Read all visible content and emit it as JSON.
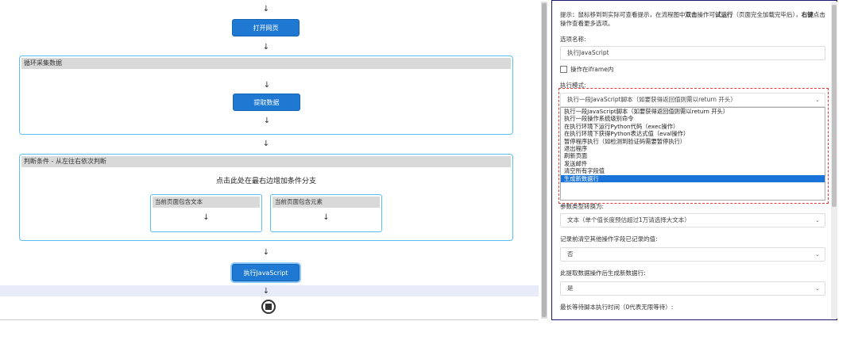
{
  "flow": {
    "open_page": "打开网页",
    "loop_block_title": "循环采集数据",
    "extract_data": "提取数据",
    "condition_block_title": "判断条件 - 从左往右依次判断",
    "branch_hint": "点击此处在最右边增加条件分支",
    "branch_1_title": "当前页面包含文本",
    "branch_2_title": "当前页面包含元素",
    "exec_js": "执行JavaScript",
    "arrow": "↓"
  },
  "panel": {
    "tip_prefix": "提示：鼠标移到到实际可查看提示，在流程图中",
    "tip_double_click": "双击",
    "tip_middle": "操作可",
    "tip_trial": "试运行",
    "tip_after": "（页面完全加载完毕后），",
    "tip_right": "右键",
    "tip_end": "点击操作查看更多选项。",
    "option_name_label": "选项名称:",
    "option_name_value": "执行JavaScript",
    "iframe_label": "操作在iframe内",
    "exec_mode_label": "执行模式:",
    "exec_mode_selected": "执行一段JavaScript脚本（如要获得返回值则需以return 开头）",
    "exec_mode_options": [
      "执行一段JavaScript脚本（如要获得返回值则需以return 开头）",
      "执行一段操作系统级别命令",
      "在执行环境下运行Python代码（exec操作）",
      "在执行环境下获得Python表达式值（eval操作）",
      "暂停程序执行（如检测到验证码需要暂停执行）",
      "退出程序",
      "刷新页面",
      "发送邮件",
      "清空所有字段值",
      "生成新数据行"
    ],
    "param_type_label": "参数类型转换为:",
    "param_type_value": "文本（单个值长度预估超过1万请选择大文本）",
    "clear_fields_label": "记录前清空其他操作字段已记录的值:",
    "clear_fields_value": "否",
    "new_row_label": "此提取数据操作后生成新数据行:",
    "new_row_value": "是",
    "max_wait_label": "最长等待脚本执行时间（0代表无限等待）:",
    "chevron": "⌄"
  }
}
